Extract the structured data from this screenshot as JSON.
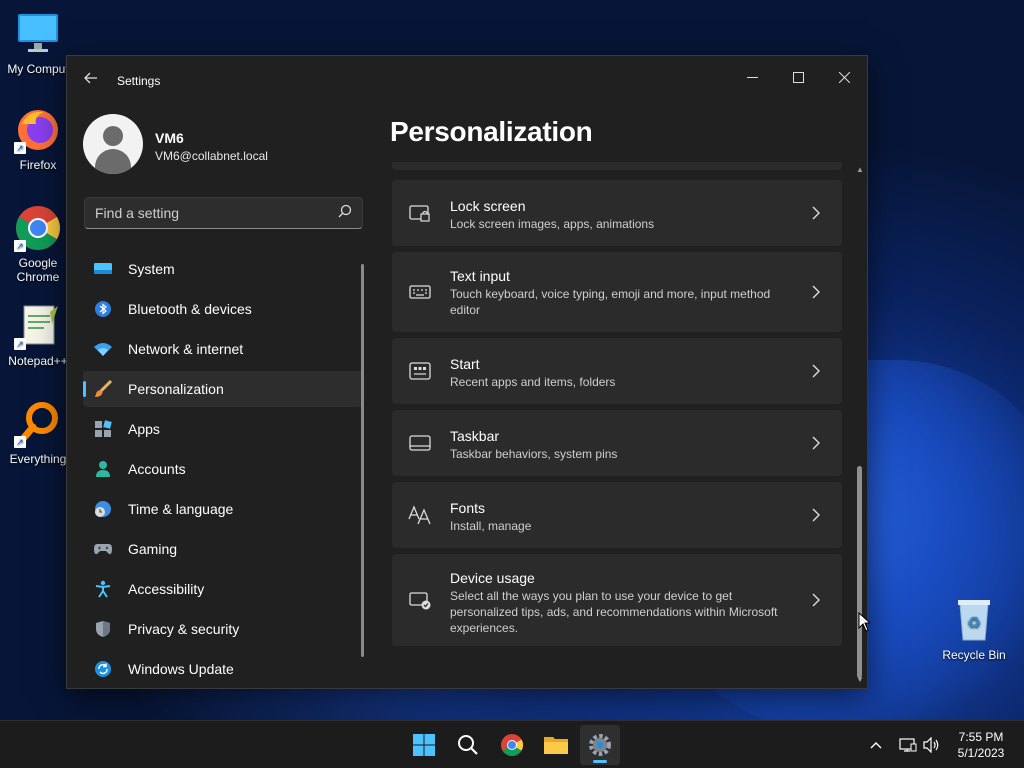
{
  "desktop": {
    "icons": [
      {
        "label": "My Comput"
      },
      {
        "label": "Firefox"
      },
      {
        "label": "Google Chrome"
      },
      {
        "label": "Notepad++"
      },
      {
        "label": "Everything"
      },
      {
        "label": "Recycle Bin"
      }
    ]
  },
  "window": {
    "title": "Settings",
    "back_icon": "back-arrow-icon",
    "controls": {
      "minimize": "—",
      "maximize": "☐",
      "close": "✕"
    }
  },
  "profile": {
    "name": "VM6",
    "email": "VM6@collabnet.local"
  },
  "search": {
    "placeholder": "Find a setting"
  },
  "nav": {
    "items": [
      {
        "label": "System",
        "icon": "monitor-icon"
      },
      {
        "label": "Bluetooth & devices",
        "icon": "bluetooth-icon"
      },
      {
        "label": "Network & internet",
        "icon": "wifi-icon"
      },
      {
        "label": "Personalization",
        "icon": "brush-icon",
        "active": true
      },
      {
        "label": "Apps",
        "icon": "apps-icon"
      },
      {
        "label": "Accounts",
        "icon": "account-icon"
      },
      {
        "label": "Time & language",
        "icon": "globe-clock-icon"
      },
      {
        "label": "Gaming",
        "icon": "gamepad-icon"
      },
      {
        "label": "Accessibility",
        "icon": "accessibility-icon"
      },
      {
        "label": "Privacy & security",
        "icon": "shield-icon"
      },
      {
        "label": "Windows Update",
        "icon": "update-icon"
      }
    ]
  },
  "page": {
    "title": "Personalization"
  },
  "cards": [
    {
      "title": "Lock screen",
      "desc": "Lock screen images, apps, animations"
    },
    {
      "title": "Text input",
      "desc": "Touch keyboard, voice typing, emoji and more, input method editor"
    },
    {
      "title": "Start",
      "desc": "Recent apps and items, folders"
    },
    {
      "title": "Taskbar",
      "desc": "Taskbar behaviors, system pins"
    },
    {
      "title": "Fonts",
      "desc": "Install, manage"
    },
    {
      "title": "Device usage",
      "desc": "Select all the ways you plan to use your device to get personalized tips, ads, and recommendations within Microsoft experiences."
    }
  ],
  "taskbar": {
    "apps": [
      "start-icon",
      "search-icon",
      "chrome-icon",
      "file-explorer-icon",
      "settings-icon"
    ],
    "clock": {
      "time": "7:55 PM",
      "date": "5/1/2023"
    }
  },
  "colors": {
    "accent": "#4cc2ff",
    "window_bg": "#202020",
    "card_bg": "#2b2b2b"
  }
}
